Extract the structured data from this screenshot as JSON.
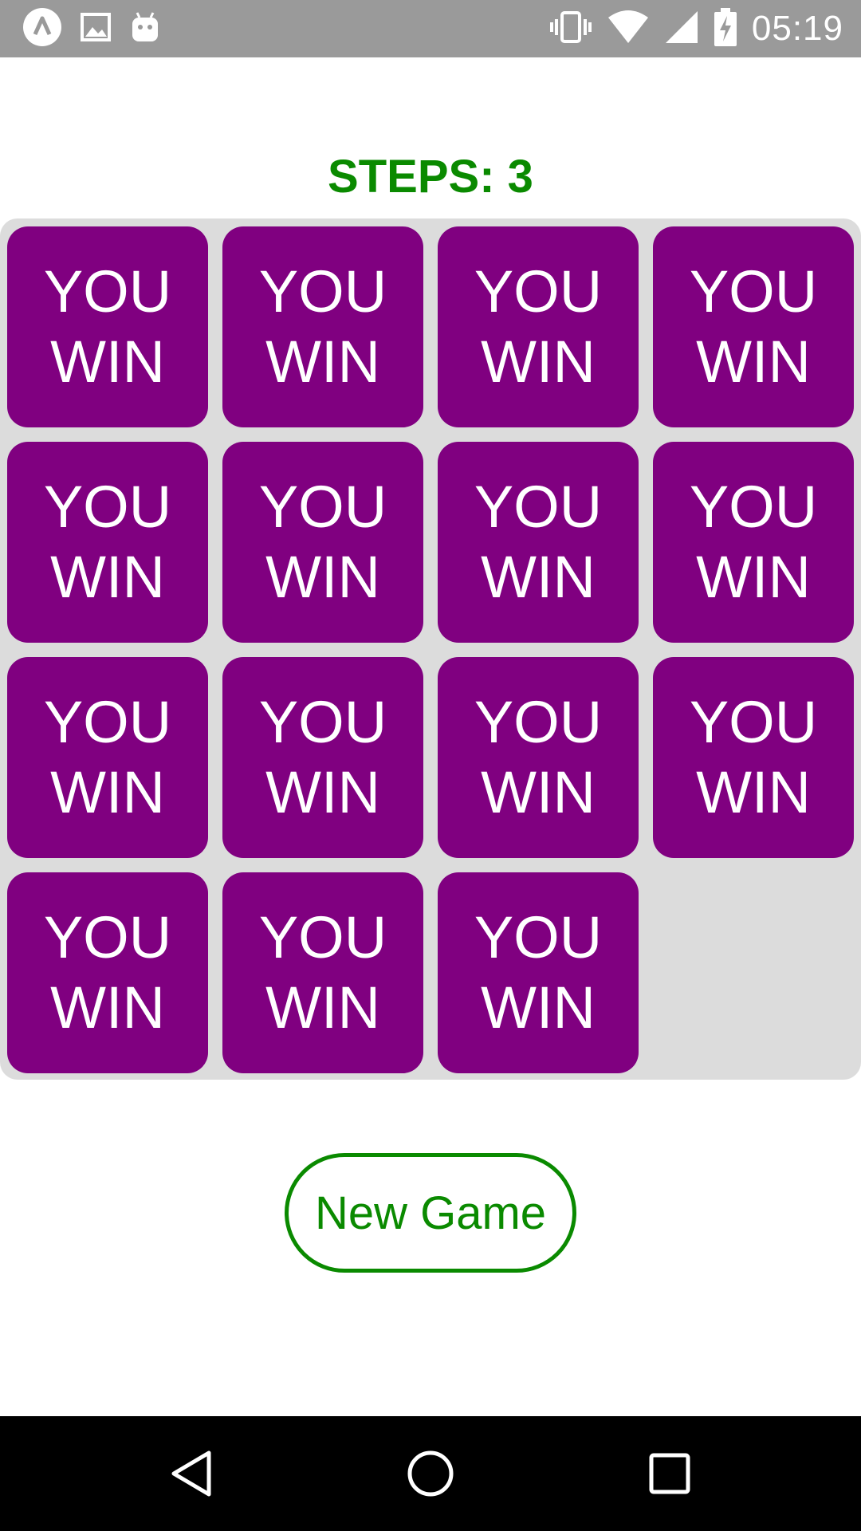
{
  "status_bar": {
    "time": "05:19",
    "left_icons": [
      "app-launcher-icon",
      "image-icon",
      "android-icon"
    ],
    "right_icons": [
      "vibrate-icon",
      "wifi-icon",
      "signal-icon",
      "battery-charging-icon"
    ]
  },
  "header": {
    "steps_label": "STEPS:",
    "steps_value": "3"
  },
  "board": {
    "tile_color": "#800080",
    "background_color": "#dcdcdc",
    "tiles": [
      {
        "line1": "YOU",
        "line2": "WIN"
      },
      {
        "line1": "YOU",
        "line2": "WIN"
      },
      {
        "line1": "YOU",
        "line2": "WIN"
      },
      {
        "line1": "YOU",
        "line2": "WIN"
      },
      {
        "line1": "YOU",
        "line2": "WIN"
      },
      {
        "line1": "YOU",
        "line2": "WIN"
      },
      {
        "line1": "YOU",
        "line2": "WIN"
      },
      {
        "line1": "YOU",
        "line2": "WIN"
      },
      {
        "line1": "YOU",
        "line2": "WIN"
      },
      {
        "line1": "YOU",
        "line2": "WIN"
      },
      {
        "line1": "YOU",
        "line2": "WIN"
      },
      {
        "line1": "YOU",
        "line2": "WIN"
      },
      {
        "line1": "YOU",
        "line2": "WIN"
      },
      {
        "line1": "YOU",
        "line2": "WIN"
      },
      {
        "line1": "YOU",
        "line2": "WIN"
      }
    ]
  },
  "actions": {
    "new_game_label": "New Game",
    "accent_color": "#0a8a00"
  },
  "nav_bar": {
    "buttons": [
      "back-icon",
      "home-icon",
      "recents-icon"
    ]
  }
}
